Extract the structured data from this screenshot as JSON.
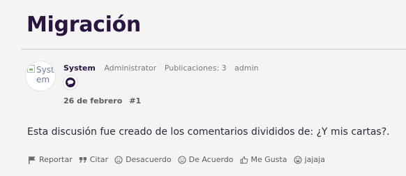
{
  "discussion": {
    "title": "Migración"
  },
  "post": {
    "author": {
      "name": "System",
      "avatar_alt": "System",
      "role": "Administrator",
      "posts": "Publicaciones: 3",
      "tag": "admin"
    },
    "date": "26 de febrero",
    "number": "#1",
    "body": "Esta discusión fue creado de los comentarios divididos de: ¿Y mis cartas?."
  },
  "reactions": [
    {
      "label": "Reportar",
      "icon": "flag-icon"
    },
    {
      "label": "Citar",
      "icon": "quote-icon"
    },
    {
      "label": "Desacuerdo",
      "icon": "frown-icon"
    },
    {
      "label": "De Acuerdo",
      "icon": "smile-icon"
    },
    {
      "label": "Me Gusta",
      "icon": "thumbs-up-icon"
    },
    {
      "label": "jajaja",
      "icon": "laugh-icon"
    }
  ],
  "colors": {
    "title": "#2a1440",
    "background": "#f4f4f5",
    "muted": "#7a7a80"
  }
}
